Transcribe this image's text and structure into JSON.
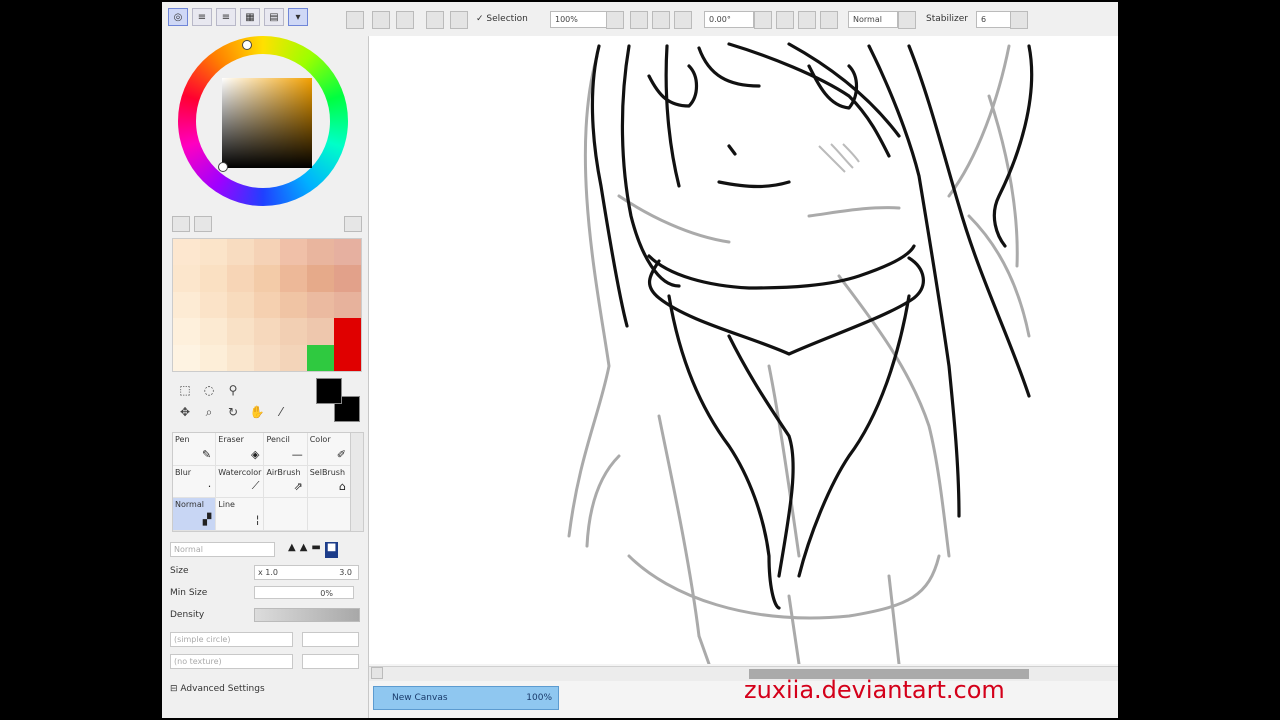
{
  "toolbar": {
    "selection_label": "Selection",
    "zoom_value": "100%",
    "rotation_value": "0.00°",
    "blend_mode": "Normal",
    "stabilizer_label": "Stabilizer",
    "stabilizer_value": "6"
  },
  "brush_panel": {
    "brushes": [
      {
        "label": "Pen",
        "icon": "pen-icon",
        "selected": false
      },
      {
        "label": "Eraser",
        "icon": "eraser-icon",
        "selected": false
      },
      {
        "label": "Pencil",
        "icon": "pencil-icon",
        "selected": false
      },
      {
        "label": "Color",
        "icon": "color-icon",
        "selected": false
      },
      {
        "label": "Blur",
        "icon": "blur-icon",
        "selected": false
      },
      {
        "label": "Watercolor",
        "icon": "watercolor-icon",
        "selected": false
      },
      {
        "label": "AirBrush",
        "icon": "airbrush-icon",
        "selected": false
      },
      {
        "label": "SelBrush",
        "icon": "selbrush-icon",
        "selected": false
      },
      {
        "label": "Normal",
        "icon": "normal-icon",
        "selected": true
      },
      {
        "label": "Line",
        "icon": "line-icon",
        "selected": false
      },
      {
        "label": "",
        "icon": "",
        "selected": false
      },
      {
        "label": "",
        "icon": "",
        "selected": false
      }
    ]
  },
  "brush_settings": {
    "blend_mode": "Normal",
    "size_label": "Size",
    "size_multiplier": "x 1.0",
    "size_value": "3.0",
    "min_size_label": "Min Size",
    "min_size_value": "0%",
    "density_label": "Density",
    "shape_label": "(simple circle)",
    "texture_label": "(no texture)",
    "advanced_label": "Advanced Settings"
  },
  "document": {
    "tab_name": "New Canvas",
    "tab_zoom": "100%"
  },
  "watermark": "zuxiia.deviantart.com",
  "colors": {
    "accent": "#6f86d8",
    "doc_tab": "#8fc7f0",
    "watermark": "#d4001a",
    "foreground": "#000000",
    "background": "#000000"
  }
}
